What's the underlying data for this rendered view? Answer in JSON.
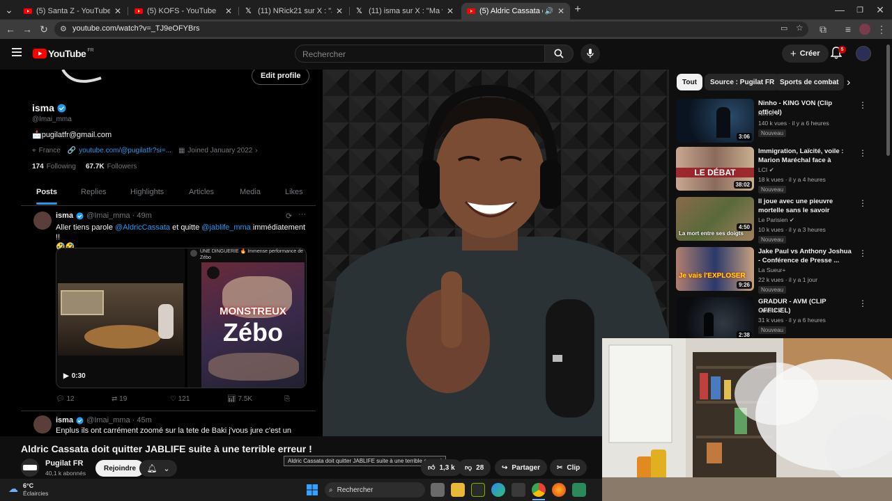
{
  "browser": {
    "tabs": [
      {
        "title": "(5) Santa Z - YouTube",
        "icon": "youtube-icon"
      },
      {
        "title": "(5) KOFS - YouTube",
        "icon": "youtube-icon"
      },
      {
        "title": "(11) NRick21 sur X : \"Je trouve ç",
        "icon": "x-icon"
      },
      {
        "title": "(11) isma sur X : \"Ma vidéo rép",
        "icon": "x-icon"
      },
      {
        "title": "(5) Aldric Cassata doit quitt",
        "icon": "youtube-icon",
        "active": true
      }
    ],
    "url": "youtube.com/watch?v=_TJ9eOFYBrs"
  },
  "youtube": {
    "logo_text": "YouTube",
    "region": "FR",
    "search_placeholder": "Rechercher",
    "create_label": "Créer",
    "notification_count": "5"
  },
  "x_profile": {
    "edit_button": "Edit profile",
    "name": "isma",
    "handle": "@Imai_mma",
    "email": "📩pugilatfr@gmail.com",
    "location": "France",
    "link": "youtube.com/@pugilatfr?si=...",
    "joined": "Joined January 2022",
    "following_count": "174",
    "following_label": "Following",
    "followers_count": "67.7K",
    "followers_label": "Followers",
    "tabs": [
      "Posts",
      "Replies",
      "Highlights",
      "Articles",
      "Media",
      "Likes"
    ],
    "post1": {
      "name": "isma",
      "handle": "@Imai_mma · 49m",
      "text_a": "Aller tiens parole ",
      "mention1": "@AldricCassata",
      "text_b": " et quitte ",
      "mention2": "@jablife_mma",
      "text_c": " immédiatement !!",
      "emoji": "🤣🤣",
      "video_duration": "0:30",
      "quote_text": "UNE DINGUERIE 🔥 Immense performance de Zébo",
      "thumb_line1": "MONSTREUX",
      "thumb_line2": "Zébo",
      "replies": "12",
      "reposts": "19",
      "likes": "121",
      "views": "7.5K"
    },
    "post2": {
      "name": "isma",
      "handle": "@Imai_mma · 45m",
      "text": "Enplus ils ont carrément zoomé sur la tete de Baki j'vous jure c'est un"
    }
  },
  "sidebar": {
    "chips": [
      "Tout",
      "Source : Pugilat FR",
      "Sports de combat"
    ],
    "videos": [
      {
        "title": "Ninho - KING VON (Clip officiel)",
        "channel": "Ninho",
        "verified": true,
        "meta": "140 k vues · il y a 6 heures",
        "badge": "Nouveau",
        "duration": "3:06",
        "thumb_text": ""
      },
      {
        "title": "Immigration, Laïcité, voile : Marion Maréchal face à Marin...",
        "channel": "LCI",
        "verified": true,
        "meta": "18 k vues · il y a 4 heures",
        "badge": "Nouveau",
        "duration": "38:02",
        "thumb_text": "LE DÉBAT"
      },
      {
        "title": "Il joue avec une pieuvre mortelle sans le savoir",
        "channel": "Le Parisien",
        "verified": true,
        "meta": "10 k vues · il y a 3 heures",
        "badge": "Nouveau",
        "duration": "4:50",
        "thumb_text": "La mort entre ses doigts"
      },
      {
        "title": "Jake Paul vs Anthony Joshua - Conférence de Presse ...",
        "channel": "La Sueur+",
        "verified": false,
        "meta": "22 k vues · il y a 1 jour",
        "badge": "Nouveau",
        "duration": "9:26",
        "thumb_text": "Je vais l'EXPLOSER"
      },
      {
        "title": "GRADUR - AVM (CLIP OFFICIEL)",
        "channel": "Gradur",
        "verified": true,
        "meta": "31 k vues · il y a 6 heures",
        "badge": "Nouveau",
        "duration": "2:38",
        "thumb_text": ""
      }
    ]
  },
  "video": {
    "title": "Aldric Cassata doit quitter JABLIFE suite à une terrible erreur !",
    "tooltip": "Aldric Cassata doit quitter JABLIFE suite à une terrible erreur !",
    "channel": "Pugilat FR",
    "subscribers": "40,1 k abonnés",
    "join_label": "Rejoindre",
    "likes": "1,3 k",
    "dislikes": "28",
    "share_label": "Partager",
    "clip_label": "Clip"
  },
  "taskbar": {
    "temperature": "6°C",
    "weather": "Éclaircies",
    "search_label": "Rechercher"
  },
  "colors": {
    "youtube_red": "#ff0000",
    "x_blue": "#1d9bf0",
    "background": "#0f0f0f"
  }
}
